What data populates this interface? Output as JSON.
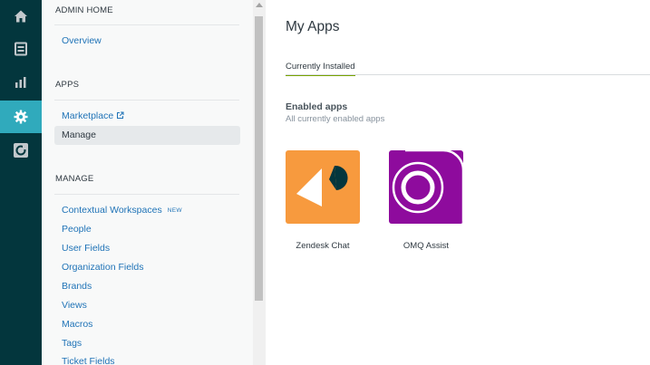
{
  "rail": {
    "items": [
      {
        "name": "home-icon"
      },
      {
        "name": "views-icon"
      },
      {
        "name": "reporting-icon"
      },
      {
        "name": "admin-gear-icon",
        "active": true
      },
      {
        "name": "apps-icon"
      }
    ]
  },
  "menu": {
    "admin_home": "ADMIN HOME",
    "overview": "Overview",
    "apps_heading": "APPS",
    "marketplace": "Marketplace",
    "manage_link": "Manage",
    "manage_heading": "MANAGE",
    "contextual_workspaces": "Contextual Workspaces",
    "new_badge": "NEW",
    "people": "People",
    "user_fields": "User Fields",
    "organization_fields": "Organization Fields",
    "brands": "Brands",
    "views": "Views",
    "macros": "Macros",
    "tags": "Tags",
    "ticket_fields": "Ticket Fields"
  },
  "main": {
    "title": "My Apps",
    "tab": "Currently Installed",
    "section_title": "Enabled apps",
    "section_subtitle": "All currently enabled apps",
    "apps": [
      {
        "name": "Zendesk Chat",
        "color": "#f79a3e",
        "icon": "zendesk-chat-logo-icon"
      },
      {
        "name": "OMQ Assist",
        "color": "#8e0b9d",
        "icon": "omq-assist-logo-icon"
      }
    ]
  },
  "colors": {
    "rail_bg": "#03363d",
    "rail_active": "#30aabc",
    "link": "#1f73b7",
    "tab_underline": "#78a300"
  }
}
